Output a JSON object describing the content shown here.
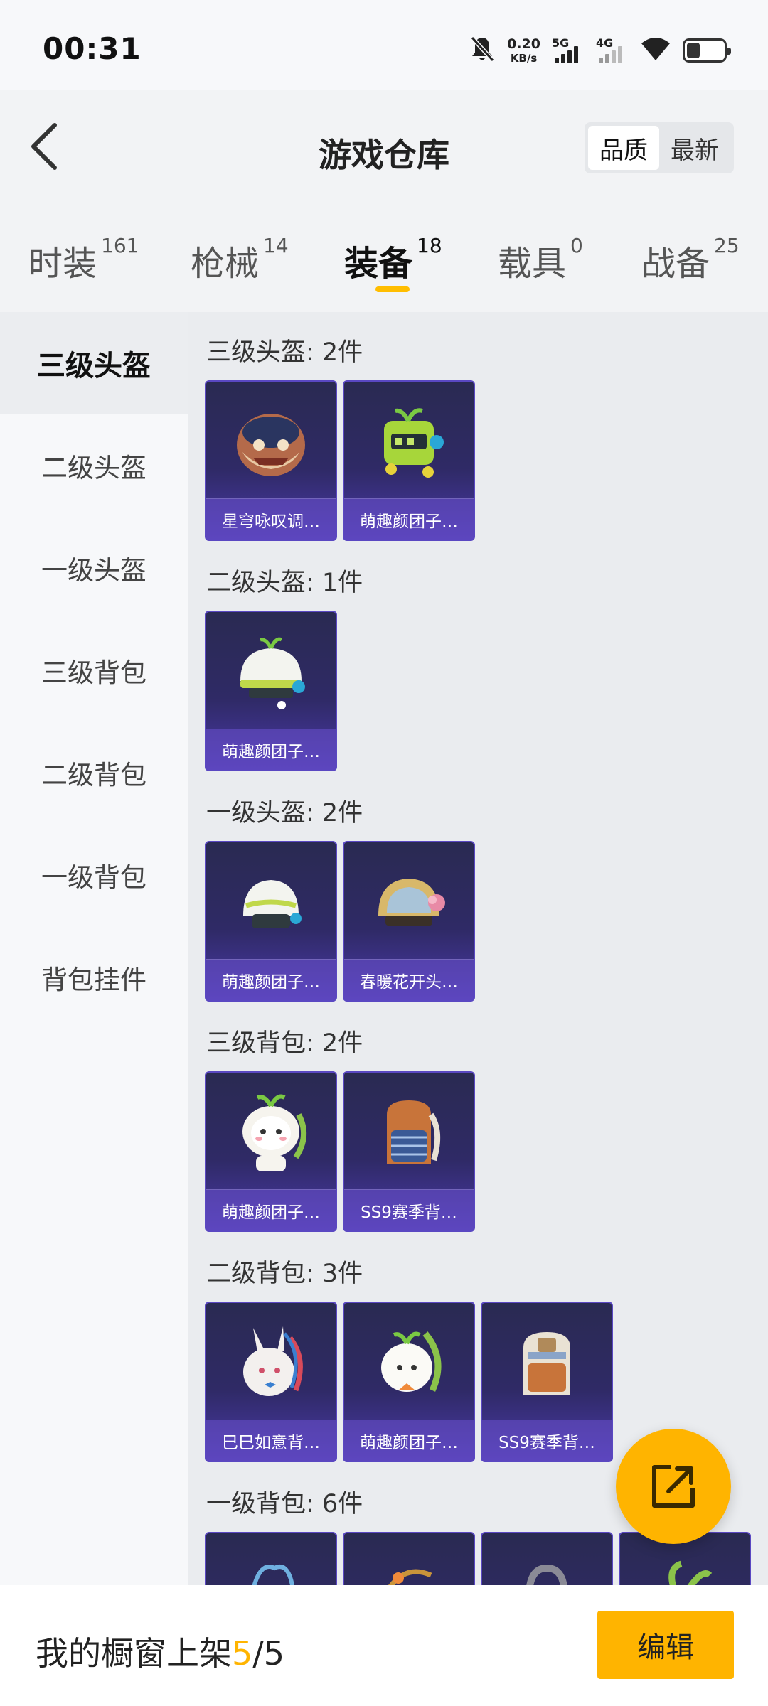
{
  "status_bar": {
    "time": "00:31",
    "speed_value": "0.20",
    "speed_unit": "KB/s",
    "sim1_label": "5G",
    "sim2_label": "4G",
    "icons": [
      "mute-icon",
      "signal-icon",
      "wifi-icon",
      "battery-icon"
    ]
  },
  "header": {
    "title": "游戏仓库",
    "sort_options": [
      "品质",
      "最新"
    ],
    "active_sort": "品质"
  },
  "tabs": [
    {
      "label": "时装",
      "count": "161"
    },
    {
      "label": "枪械",
      "count": "14"
    },
    {
      "label": "装备",
      "count": "18"
    },
    {
      "label": "载具",
      "count": "0"
    },
    {
      "label": "战备",
      "count": "25"
    }
  ],
  "active_tab": "装备",
  "sidebar": {
    "items": [
      "三级头盔",
      "二级头盔",
      "一级头盔",
      "三级背包",
      "二级背包",
      "一级背包",
      "背包挂件"
    ],
    "active": "三级头盔"
  },
  "sections": [
    {
      "title": "三级头盔: 2件",
      "items": [
        "星穹咏叹调…",
        "萌趣颜团子…"
      ]
    },
    {
      "title": "二级头盔: 1件",
      "items": [
        "萌趣颜团子…"
      ]
    },
    {
      "title": "一级头盔: 2件",
      "items": [
        "萌趣颜团子…",
        "春暖花开头…"
      ]
    },
    {
      "title": "三级背包: 2件",
      "items": [
        "萌趣颜团子…",
        "SS9赛季背…"
      ]
    },
    {
      "title": "二级背包: 3件",
      "items": [
        "巳巳如意背…",
        "萌趣颜团子…",
        "SS9赛季背…"
      ]
    },
    {
      "title": "一级背包: 6件",
      "items": [
        "",
        "",
        "",
        ""
      ]
    }
  ],
  "footer": {
    "showcase_label": "我的橱窗上架",
    "showcase_current": "5",
    "showcase_sep": "/",
    "showcase_total": "5",
    "edit_label": "编辑"
  },
  "colors": {
    "accent": "#ffb400",
    "card_bg": "#2f2a66",
    "card_label_bg": "#6c52d2"
  }
}
